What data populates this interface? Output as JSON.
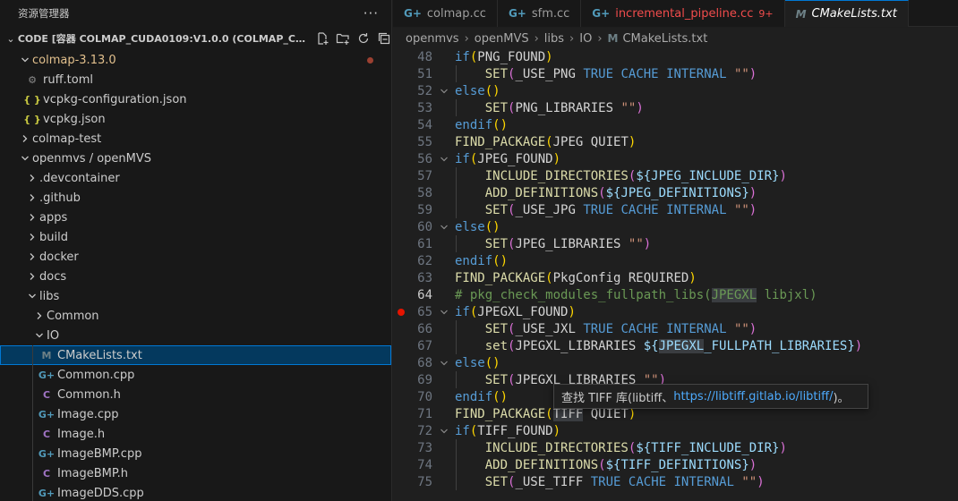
{
  "sidebar": {
    "title": "资源管理器",
    "more": "···",
    "workspace_title": "CODE [容器 COLMAP_CUDA0109:V1.0.0 (COLMAP_CUDA0...",
    "items": [
      {
        "label": "colmap-3.13.0",
        "depth": 1,
        "kind": "folder-open",
        "modified": true
      },
      {
        "label": "ruff.toml",
        "depth": 2,
        "kind": "gear"
      },
      {
        "label": "vcpkg-configuration.json",
        "depth": 2,
        "kind": "json"
      },
      {
        "label": "vcpkg.json",
        "depth": 2,
        "kind": "json"
      },
      {
        "label": "colmap-test",
        "depth": 1,
        "kind": "folder"
      },
      {
        "label": "openmvs / openMVS",
        "depth": 1,
        "kind": "folder-open"
      },
      {
        "label": ".devcontainer",
        "depth": 2,
        "kind": "folder"
      },
      {
        "label": ".github",
        "depth": 2,
        "kind": "folder"
      },
      {
        "label": "apps",
        "depth": 2,
        "kind": "folder"
      },
      {
        "label": "build",
        "depth": 2,
        "kind": "folder"
      },
      {
        "label": "docker",
        "depth": 2,
        "kind": "folder"
      },
      {
        "label": "docs",
        "depth": 2,
        "kind": "folder"
      },
      {
        "label": "libs",
        "depth": 2,
        "kind": "folder-open"
      },
      {
        "label": "Common",
        "depth": 3,
        "kind": "folder"
      },
      {
        "label": "IO",
        "depth": 3,
        "kind": "folder-open"
      },
      {
        "label": "CMakeLists.txt",
        "depth": 4,
        "kind": "cmake",
        "selected": true
      },
      {
        "label": "Common.cpp",
        "depth": 4,
        "kind": "cpp"
      },
      {
        "label": "Common.h",
        "depth": 4,
        "kind": "h"
      },
      {
        "label": "Image.cpp",
        "depth": 4,
        "kind": "cpp"
      },
      {
        "label": "Image.h",
        "depth": 4,
        "kind": "h"
      },
      {
        "label": "ImageBMP.cpp",
        "depth": 4,
        "kind": "cpp"
      },
      {
        "label": "ImageBMP.h",
        "depth": 4,
        "kind": "h"
      },
      {
        "label": "ImageDDS.cpp",
        "depth": 4,
        "kind": "cpp"
      }
    ]
  },
  "tabs": [
    {
      "label": "colmap.cc",
      "icon": "cpp"
    },
    {
      "label": "sfm.cc",
      "icon": "cpp"
    },
    {
      "label": "incremental_pipeline.cc",
      "icon": "cpp",
      "error": true,
      "badge": "9+"
    },
    {
      "label": "CMakeLists.txt",
      "icon": "cmake",
      "active": true
    }
  ],
  "breadcrumb": [
    "openmvs",
    "openMVS",
    "libs",
    "IO",
    "CMakeLists.txt"
  ],
  "editor": {
    "current_line": 64,
    "breakpoint_line": 65,
    "lines": [
      {
        "n": "48",
        "fold": "",
        "tokens": [
          [
            "k",
            "if"
          ],
          [
            "p",
            "("
          ],
          [
            "",
            "PNG_FOUND"
          ],
          [
            "p",
            ")"
          ]
        ]
      },
      {
        "n": "51",
        "fold": "",
        "tokens": [
          [
            "",
            "    "
          ],
          [
            "f",
            "SET"
          ],
          [
            "pk",
            "("
          ],
          [
            "",
            "_USE_PNG "
          ],
          [
            "k",
            "TRUE"
          ],
          [
            "",
            " "
          ],
          [
            "k",
            "CACHE"
          ],
          [
            "",
            " "
          ],
          [
            "k",
            "INTERNAL"
          ],
          [
            "",
            " "
          ],
          [
            "s",
            "\"\""
          ],
          [
            "pk",
            ")"
          ]
        ]
      },
      {
        "n": "52",
        "fold": "v",
        "tokens": [
          [
            "k",
            "else"
          ],
          [
            "p",
            "()"
          ]
        ]
      },
      {
        "n": "53",
        "fold": "",
        "tokens": [
          [
            "",
            "    "
          ],
          [
            "f",
            "SET"
          ],
          [
            "pk",
            "("
          ],
          [
            "",
            "PNG_LIBRARIES "
          ],
          [
            "s",
            "\"\""
          ],
          [
            "pk",
            ")"
          ]
        ]
      },
      {
        "n": "54",
        "fold": "",
        "tokens": [
          [
            "k",
            "endif"
          ],
          [
            "p",
            "()"
          ]
        ]
      },
      {
        "n": "55",
        "fold": "",
        "tokens": [
          [
            "f",
            "FIND_PACKAGE"
          ],
          [
            "p",
            "("
          ],
          [
            "",
            "JPEG QUIET"
          ],
          [
            "p",
            ")"
          ]
        ]
      },
      {
        "n": "56",
        "fold": "v",
        "tokens": [
          [
            "k",
            "if"
          ],
          [
            "p",
            "("
          ],
          [
            "",
            "JPEG_FOUND"
          ],
          [
            "p",
            ")"
          ]
        ]
      },
      {
        "n": "57",
        "fold": "",
        "tokens": [
          [
            "",
            "    "
          ],
          [
            "f",
            "INCLUDE_DIRECTORIES"
          ],
          [
            "pk",
            "("
          ],
          [
            "v",
            "${"
          ],
          [
            "v",
            "JPEG_INCLUDE_DIR"
          ],
          [
            "v",
            "}"
          ],
          [
            "pk",
            ")"
          ]
        ]
      },
      {
        "n": "58",
        "fold": "",
        "tokens": [
          [
            "",
            "    "
          ],
          [
            "f",
            "ADD_DEFINITIONS"
          ],
          [
            "pk",
            "("
          ],
          [
            "v",
            "${"
          ],
          [
            "v",
            "JPEG_DEFINITIONS"
          ],
          [
            "v",
            "}"
          ],
          [
            "pk",
            ")"
          ]
        ]
      },
      {
        "n": "59",
        "fold": "",
        "tokens": [
          [
            "",
            "    "
          ],
          [
            "f",
            "SET"
          ],
          [
            "pk",
            "("
          ],
          [
            "",
            "_USE_JPG "
          ],
          [
            "k",
            "TRUE"
          ],
          [
            "",
            " "
          ],
          [
            "k",
            "CACHE"
          ],
          [
            "",
            " "
          ],
          [
            "k",
            "INTERNAL"
          ],
          [
            "",
            " "
          ],
          [
            "s",
            "\"\""
          ],
          [
            "pk",
            ")"
          ]
        ]
      },
      {
        "n": "60",
        "fold": "v",
        "tokens": [
          [
            "k",
            "else"
          ],
          [
            "p",
            "()"
          ]
        ]
      },
      {
        "n": "61",
        "fold": "",
        "tokens": [
          [
            "",
            "    "
          ],
          [
            "f",
            "SET"
          ],
          [
            "pk",
            "("
          ],
          [
            "",
            "JPEG_LIBRARIES "
          ],
          [
            "s",
            "\"\""
          ],
          [
            "pk",
            ")"
          ]
        ]
      },
      {
        "n": "62",
        "fold": "",
        "tokens": [
          [
            "k",
            "endif"
          ],
          [
            "p",
            "()"
          ]
        ]
      },
      {
        "n": "63",
        "fold": "",
        "tokens": [
          [
            "f",
            "FIND_PACKAGE"
          ],
          [
            "p",
            "("
          ],
          [
            "",
            "PkgConfig REQUIRED"
          ],
          [
            "p",
            ")"
          ]
        ]
      },
      {
        "n": "64",
        "fold": "",
        "tokens": [
          [
            "c",
            "# pkg_check_modules_fullpath_libs("
          ],
          [
            "chl",
            "JPEGXL"
          ],
          [
            "c",
            " libjxl)"
          ]
        ]
      },
      {
        "n": "65",
        "fold": "v",
        "tokens": [
          [
            "k",
            "if"
          ],
          [
            "p",
            "("
          ],
          [
            "",
            "JPEGXL_FOUND"
          ],
          [
            "p",
            ")"
          ]
        ]
      },
      {
        "n": "66",
        "fold": "",
        "tokens": [
          [
            "",
            "    "
          ],
          [
            "f",
            "SET"
          ],
          [
            "pk",
            "("
          ],
          [
            "",
            "_USE_JXL "
          ],
          [
            "k",
            "TRUE"
          ],
          [
            "",
            " "
          ],
          [
            "k",
            "CACHE"
          ],
          [
            "",
            " "
          ],
          [
            "k",
            "INTERNAL"
          ],
          [
            "",
            " "
          ],
          [
            "s",
            "\"\""
          ],
          [
            "pk",
            ")"
          ]
        ]
      },
      {
        "n": "67",
        "fold": "",
        "tokens": [
          [
            "",
            "    "
          ],
          [
            "f",
            "set"
          ],
          [
            "pk",
            "("
          ],
          [
            "",
            "JPEGXL_LIBRARIES "
          ],
          [
            "v",
            "${"
          ],
          [
            "vhl",
            "JPEGXL"
          ],
          [
            "v",
            "_FULLPATH_LIBRARIES}"
          ],
          [
            "pk",
            ")"
          ]
        ]
      },
      {
        "n": "68",
        "fold": "v",
        "tokens": [
          [
            "k",
            "else"
          ],
          [
            "p",
            "()"
          ]
        ]
      },
      {
        "n": "69",
        "fold": "",
        "tokens": [
          [
            "",
            "    "
          ],
          [
            "f",
            "SET"
          ],
          [
            "pk",
            "("
          ],
          [
            "",
            "JPEGXL_LIBRARIES "
          ],
          [
            "s",
            "\"\""
          ],
          [
            "pk",
            ")"
          ]
        ]
      },
      {
        "n": "70",
        "fold": "",
        "tokens": [
          [
            "k",
            "endif"
          ],
          [
            "p",
            "()"
          ]
        ]
      },
      {
        "n": "71",
        "fold": "",
        "tokens": [
          [
            "f",
            "FIND_PACKAGE"
          ],
          [
            "p",
            "("
          ],
          [
            "hl",
            "TIFF"
          ],
          [
            "",
            " QUIET"
          ],
          [
            "p",
            ")"
          ]
        ]
      },
      {
        "n": "72",
        "fold": "v",
        "tokens": [
          [
            "k",
            "if"
          ],
          [
            "p",
            "("
          ],
          [
            "",
            "TIFF_FOUND"
          ],
          [
            "p",
            ")"
          ]
        ]
      },
      {
        "n": "73",
        "fold": "",
        "tokens": [
          [
            "",
            "    "
          ],
          [
            "f",
            "INCLUDE_DIRECTORIES"
          ],
          [
            "pk",
            "("
          ],
          [
            "v",
            "${"
          ],
          [
            "v",
            "TIFF_INCLUDE_DIR"
          ],
          [
            "v",
            "}"
          ],
          [
            "pk",
            ")"
          ]
        ]
      },
      {
        "n": "74",
        "fold": "",
        "tokens": [
          [
            "",
            "    "
          ],
          [
            "f",
            "ADD_DEFINITIONS"
          ],
          [
            "pk",
            "("
          ],
          [
            "v",
            "${"
          ],
          [
            "v",
            "TIFF_DEFINITIONS"
          ],
          [
            "v",
            "}"
          ],
          [
            "pk",
            ")"
          ]
        ]
      },
      {
        "n": "75",
        "fold": "",
        "tokens": [
          [
            "",
            "    "
          ],
          [
            "f",
            "SET"
          ],
          [
            "pk",
            "("
          ],
          [
            "",
            "_USE_TIFF "
          ],
          [
            "k",
            "TRUE"
          ],
          [
            "",
            " "
          ],
          [
            "k",
            "CACHE"
          ],
          [
            "",
            " "
          ],
          [
            "k",
            "INTERNAL"
          ],
          [
            "",
            " "
          ],
          [
            "s",
            "\"\""
          ],
          [
            "pk",
            ")"
          ]
        ]
      }
    ]
  },
  "tooltip": {
    "prefix": "查找 TIFF 库(libtiff、",
    "link": "https://libtiff.gitlab.io/libtiff/",
    "suffix": ")。"
  },
  "colors": {
    "accent": "#0078d4",
    "selection": "#04395e",
    "error": "#f14c4c",
    "modified": "#e2c08d",
    "breakpoint": "#e51400"
  }
}
